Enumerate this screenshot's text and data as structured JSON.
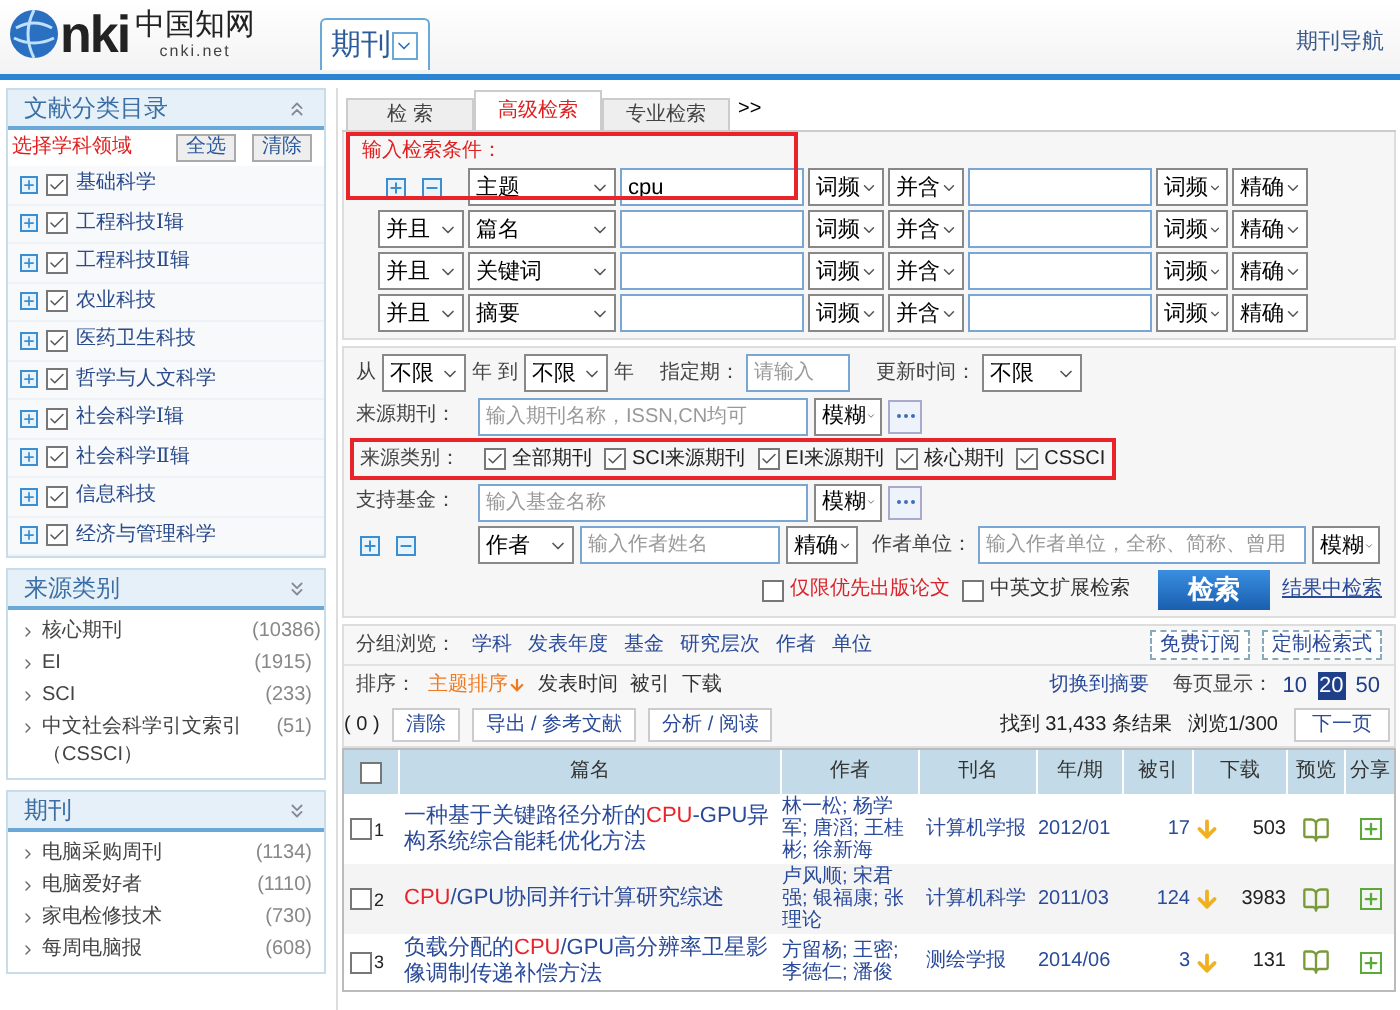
{
  "header": {
    "logo": {
      "letters": "nki",
      "name_cn": "中国知网",
      "domain": "cnki.net"
    },
    "db_tab": "期刊",
    "nav_link": "期刊导航"
  },
  "sidebar": {
    "categories": {
      "title": "文献分类目录",
      "hint": "选择学科领域",
      "buttons": [
        "全选",
        "清除"
      ],
      "items": [
        {
          "label": "基础科学",
          "checked": true
        },
        {
          "label": "工程科技Ⅰ辑",
          "checked": true
        },
        {
          "label": "工程科技Ⅱ辑",
          "checked": true
        },
        {
          "label": "农业科技",
          "checked": true
        },
        {
          "label": "医药卫生科技",
          "checked": true
        },
        {
          "label": "哲学与人文科学",
          "checked": true
        },
        {
          "label": "社会科学Ⅰ辑",
          "checked": true
        },
        {
          "label": "社会科学Ⅱ辑",
          "checked": true
        },
        {
          "label": "信息科技",
          "checked": true
        },
        {
          "label": "经济与管理科学",
          "checked": true
        }
      ]
    },
    "source_types": {
      "title": "来源类别",
      "items": [
        {
          "label": "核心期刊",
          "count": "(10386)"
        },
        {
          "label": "EI",
          "count": "(1915)"
        },
        {
          "label": "SCI",
          "count": "(233)"
        },
        {
          "label": "中文社会科学引文索引（CSSCI）",
          "count": "(51)"
        }
      ]
    },
    "journals": {
      "title": "期刊",
      "items": [
        {
          "label": "电脑采购周刊",
          "count": "(1134)"
        },
        {
          "label": "电脑爱好者",
          "count": "(1110)"
        },
        {
          "label": "家电检修技术",
          "count": "(730)"
        },
        {
          "label": "每周电脑报",
          "count": "(608)"
        }
      ]
    }
  },
  "search": {
    "tabs": [
      {
        "label": "检 索",
        "selected": false
      },
      {
        "label": "高级检索",
        "selected": true
      },
      {
        "label": "专业检索",
        "selected": false
      }
    ],
    "more": ">>",
    "condition_label": "输入检索条件：",
    "rows": [
      {
        "field": "主题",
        "value": "cpu",
        "freq": "词频",
        "combine": "并含",
        "freq2": "词频",
        "match": "精确"
      },
      {
        "logic": "并且",
        "field": "篇名",
        "freq": "词频",
        "combine": "并含",
        "freq2": "词频",
        "match": "精确"
      },
      {
        "logic": "并且",
        "field": "关键词",
        "freq": "词频",
        "combine": "并含",
        "freq2": "词频",
        "match": "精确"
      },
      {
        "logic": "并且",
        "field": "摘要",
        "freq": "词频",
        "combine": "并含",
        "freq2": "词频",
        "match": "精确"
      }
    ]
  },
  "filters": {
    "from_label": "从",
    "from": "不限",
    "to_label": "年 到",
    "to": "不限",
    "year_label": "年",
    "period_label": "指定期：",
    "period_placeholder": "请输入",
    "update_label": "更新时间：",
    "update": "不限",
    "journal": {
      "label": "来源期刊：",
      "placeholder": "输入期刊名称，ISSN,CN均可",
      "match": "模糊"
    },
    "source_types": {
      "label": "来源类别：",
      "options": [
        {
          "label": "全部期刊",
          "checked": true
        },
        {
          "label": "SCI来源期刊",
          "checked": true
        },
        {
          "label": "EI来源期刊",
          "checked": true
        },
        {
          "label": "核心期刊",
          "checked": true
        },
        {
          "label": "CSSCI",
          "checked": true
        }
      ]
    },
    "fund": {
      "label": "支持基金：",
      "placeholder": "输入基金名称",
      "match": "模糊"
    },
    "author": {
      "field": "作者",
      "placeholder": "输入作者姓名",
      "match": "精确",
      "unit_label": "作者单位：",
      "unit_placeholder": "输入作者单位，全称、简称、曾用",
      "unit_match": "模糊"
    },
    "options": [
      {
        "label": "仅限优先出版论文",
        "checked": false,
        "color": "#d9232a"
      },
      {
        "label": "中英文扩展检索",
        "checked": false,
        "color": "#333333"
      }
    ],
    "search_button": "检索",
    "within_link": "结果中检索"
  },
  "results": {
    "group_label": "分组浏览：",
    "groups": [
      "学科",
      "发表年度",
      "基金",
      "研究层次",
      "作者",
      "单位"
    ],
    "buttons": [
      "免费订阅",
      "定制检索式"
    ],
    "sort_label": "排序：",
    "sorts": [
      {
        "label": "主题排序",
        "selected": true
      },
      {
        "label": "发表时间",
        "selected": false
      },
      {
        "label": "被引",
        "selected": false
      },
      {
        "label": "下载",
        "selected": false
      }
    ],
    "switch_link": "切换到摘要",
    "per_page_label": "每页显示：",
    "per_page": [
      {
        "label": "10",
        "selected": false
      },
      {
        "label": "20",
        "selected": true
      },
      {
        "label": "50",
        "selected": false
      }
    ],
    "selected_count": "( 0 )",
    "actions": [
      "清除",
      "导出 / 参考文献",
      "分析 / 阅读"
    ],
    "found": "找到 31,433 条结果",
    "page": "浏览1/300",
    "next": "下一页",
    "table": {
      "select_all": {
        "checked": false
      },
      "columns": [
        "篇名",
        "作者",
        "刊名",
        "年/期",
        "被引",
        "下载",
        "预览",
        "分享"
      ],
      "rows": [
        {
          "num": "1",
          "checked": false,
          "title": [
            {
              "text": "一种基于关键路径分析的",
              "hit": false
            },
            {
              "text": "CPU",
              "hit": true
            },
            {
              "text": "-GPU异构系统综合能耗优化方法",
              "hit": false
            }
          ],
          "authors": "林一松; 杨学军; 唐滔; 王桂彬; 徐新海",
          "journal": "计算机学报",
          "issue": "2012/01",
          "cited": "17",
          "downloads": "503"
        },
        {
          "num": "2",
          "checked": false,
          "title": [
            {
              "text": "CPU",
              "hit": true
            },
            {
              "text": "/GPU协同并行计算研究综述",
              "hit": false
            }
          ],
          "authors": "卢风顺; 宋君强; 银福康; 张理论",
          "journal": "计算机科学",
          "issue": "2011/03",
          "cited": "124",
          "downloads": "3983"
        },
        {
          "num": "3",
          "checked": false,
          "title": [
            {
              "text": "负载分配的",
              "hit": false
            },
            {
              "text": "CPU",
              "hit": true
            },
            {
              "text": "/GPU高分辨率卫星影像调制传递补偿方法",
              "hit": false
            }
          ],
          "authors": "方留杨; 王密; 李德仁; 潘俊",
          "journal": "测绘学报",
          "issue": "2014/06",
          "cited": "3",
          "downloads": "131"
        }
      ]
    }
  }
}
